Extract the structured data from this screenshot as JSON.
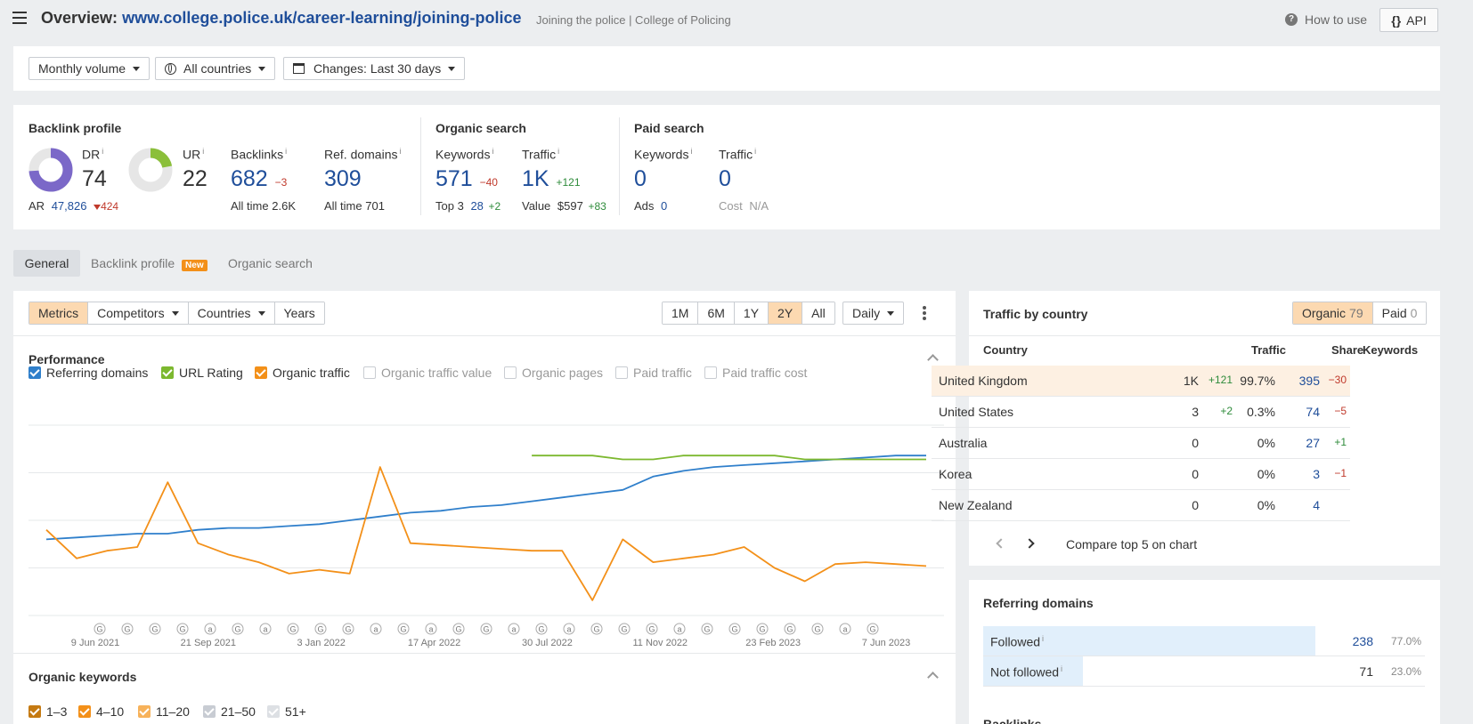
{
  "header": {
    "title_prefix": "Overview:",
    "url": "www.college.police.uk/career-learning/joining-police",
    "page_title": "Joining the police | College of Policing",
    "how_to_use": "How to use",
    "api": "API"
  },
  "filters": {
    "volume": "Monthly volume",
    "countries": "All countries",
    "changes": "Changes: Last 30 days"
  },
  "backlink_profile": {
    "title": "Backlink profile",
    "dr_label": "DR",
    "dr_value": "74",
    "ur_label": "UR",
    "ur_value": "22",
    "ar_label": "AR",
    "ar_value": "47,826",
    "ar_change": "424",
    "backlinks_label": "Backlinks",
    "backlinks_value": "682",
    "backlinks_change": "−3",
    "backlinks_all_label": "All time",
    "backlinks_all": "2.6K",
    "refdomains_label": "Ref. domains",
    "refdomains_value": "309",
    "refdomains_all_label": "All time",
    "refdomains_all": "701"
  },
  "organic_search": {
    "title": "Organic search",
    "keywords_label": "Keywords",
    "keywords_value": "571",
    "keywords_change": "−40",
    "top3_label": "Top 3",
    "top3_value": "28",
    "top3_change": "+2",
    "traffic_label": "Traffic",
    "traffic_value": "1K",
    "traffic_change": "+121",
    "value_label": "Value",
    "value_value": "$597",
    "value_change": "+83"
  },
  "paid_search": {
    "title": "Paid search",
    "keywords_label": "Keywords",
    "keywords_value": "0",
    "ads_label": "Ads",
    "ads_value": "0",
    "traffic_label": "Traffic",
    "traffic_value": "0",
    "cost_label": "Cost",
    "cost_value": "N/A"
  },
  "tabs": [
    {
      "label": "General",
      "active": true
    },
    {
      "label": "Backlink profile",
      "badge": "New"
    },
    {
      "label": "Organic search"
    }
  ],
  "chart_toolbar": {
    "metrics": "Metrics",
    "competitors": "Competitors",
    "countries": "Countries",
    "years": "Years",
    "ranges": [
      "1M",
      "6M",
      "1Y",
      "2Y",
      "All"
    ],
    "active_range": "2Y",
    "interval": "Daily"
  },
  "performance": {
    "title": "Performance",
    "legend": [
      {
        "label": "Referring domains",
        "checked": true,
        "color": "#2f7fcb"
      },
      {
        "label": "URL Rating",
        "checked": true,
        "color": "#7cb82f"
      },
      {
        "label": "Organic traffic",
        "checked": true,
        "color": "#f39019"
      },
      {
        "label": "Organic traffic value",
        "checked": false
      },
      {
        "label": "Organic pages",
        "checked": false
      },
      {
        "label": "Paid traffic",
        "checked": false
      },
      {
        "label": "Paid traffic cost",
        "checked": false
      }
    ],
    "x_labels": [
      "9 Jun 2021",
      "21 Sep 2021",
      "3 Jan 2022",
      "17 Apr 2022",
      "30 Jul 2022",
      "11 Nov 2022",
      "23 Feb 2023",
      "7 Jun 2023"
    ],
    "markers": [
      "G",
      "G",
      "G",
      "G",
      "a",
      "G",
      "a",
      "G",
      "G",
      "G",
      "a",
      "G",
      "a",
      "G",
      "G",
      "a",
      "G",
      "a",
      "G",
      "G",
      "G",
      "a",
      "G",
      "G",
      "G",
      "G",
      "G",
      "a",
      "G"
    ]
  },
  "chart_data": {
    "type": "line",
    "x_range": [
      "9 Jun 2021",
      "7 Jun 2023"
    ],
    "x_ticks": [
      "9 Jun 2021",
      "21 Sep 2021",
      "3 Jan 2022",
      "17 Apr 2022",
      "30 Jul 2022",
      "11 Nov 2022",
      "23 Feb 2023",
      "7 Jun 2023"
    ],
    "grid": true,
    "y_axis_labels": "none shown",
    "series": [
      {
        "name": "Referring domains",
        "color": "#2f7fcb",
        "values": [
          0.4,
          0.41,
          0.42,
          0.43,
          0.43,
          0.45,
          0.46,
          0.46,
          0.47,
          0.48,
          0.5,
          0.52,
          0.54,
          0.55,
          0.57,
          0.58,
          0.6,
          0.62,
          0.64,
          0.66,
          0.73,
          0.76,
          0.78,
          0.79,
          0.8,
          0.81,
          0.82,
          0.83,
          0.84,
          0.84
        ]
      },
      {
        "name": "URL Rating",
        "color": "#7cb82f",
        "values": [
          null,
          null,
          null,
          null,
          null,
          null,
          null,
          null,
          null,
          null,
          null,
          null,
          null,
          null,
          null,
          null,
          0.84,
          0.84,
          0.84,
          0.82,
          0.82,
          0.84,
          0.84,
          0.84,
          0.84,
          0.82,
          0.82,
          0.82,
          0.82,
          0.82
        ]
      },
      {
        "name": "Organic traffic",
        "color": "#f39019",
        "values": [
          0.45,
          0.3,
          0.34,
          0.36,
          0.7,
          0.38,
          0.32,
          0.28,
          0.22,
          0.24,
          0.22,
          0.78,
          0.38,
          0.37,
          0.36,
          0.35,
          0.34,
          0.34,
          0.08,
          0.4,
          0.28,
          0.3,
          0.32,
          0.36,
          0.25,
          0.18,
          0.27,
          0.28,
          0.27,
          0.26
        ]
      }
    ]
  },
  "organic_keywords": {
    "title": "Organic keywords",
    "legend": [
      {
        "label": "1–3",
        "checked": true,
        "color": "#c57a12"
      },
      {
        "label": "4–10",
        "checked": true,
        "color": "#f39019"
      },
      {
        "label": "11–20",
        "checked": true,
        "color": "#f7b25a"
      },
      {
        "label": "21–50",
        "checked": false
      },
      {
        "label": "51+",
        "checked": false
      }
    ]
  },
  "traffic_by_country": {
    "title": "Traffic by country",
    "organic_label": "Organic",
    "organic_count": "79",
    "paid_label": "Paid",
    "paid_count": "0",
    "columns": [
      "Country",
      "Traffic",
      "Share",
      "Keywords"
    ],
    "rows": [
      {
        "country": "United Kingdom",
        "traffic": "1K",
        "traffic_change": "+121",
        "share": "99.7%",
        "keywords": "395",
        "keywords_change": "−30"
      },
      {
        "country": "United States",
        "traffic": "3",
        "traffic_change": "+2",
        "share": "0.3%",
        "keywords": "74",
        "keywords_change": "−5"
      },
      {
        "country": "Australia",
        "traffic": "0",
        "traffic_change": "",
        "share": "0%",
        "keywords": "27",
        "keywords_change": "+1"
      },
      {
        "country": "Korea",
        "traffic": "0",
        "traffic_change": "",
        "share": "0%",
        "keywords": "3",
        "keywords_change": "−1"
      },
      {
        "country": "New Zealand",
        "traffic": "0",
        "traffic_change": "",
        "share": "0%",
        "keywords": "4",
        "keywords_change": ""
      }
    ],
    "compare": "Compare top 5 on chart"
  },
  "referring_domains": {
    "title": "Referring domains",
    "rows": [
      {
        "label": "Followed",
        "value": "238",
        "percent": "77.0%",
        "fraction": 0.77
      },
      {
        "label": "Not followed",
        "value": "71",
        "percent": "23.0%",
        "fraction": 0.23
      }
    ],
    "next_title": "Backlinks"
  }
}
